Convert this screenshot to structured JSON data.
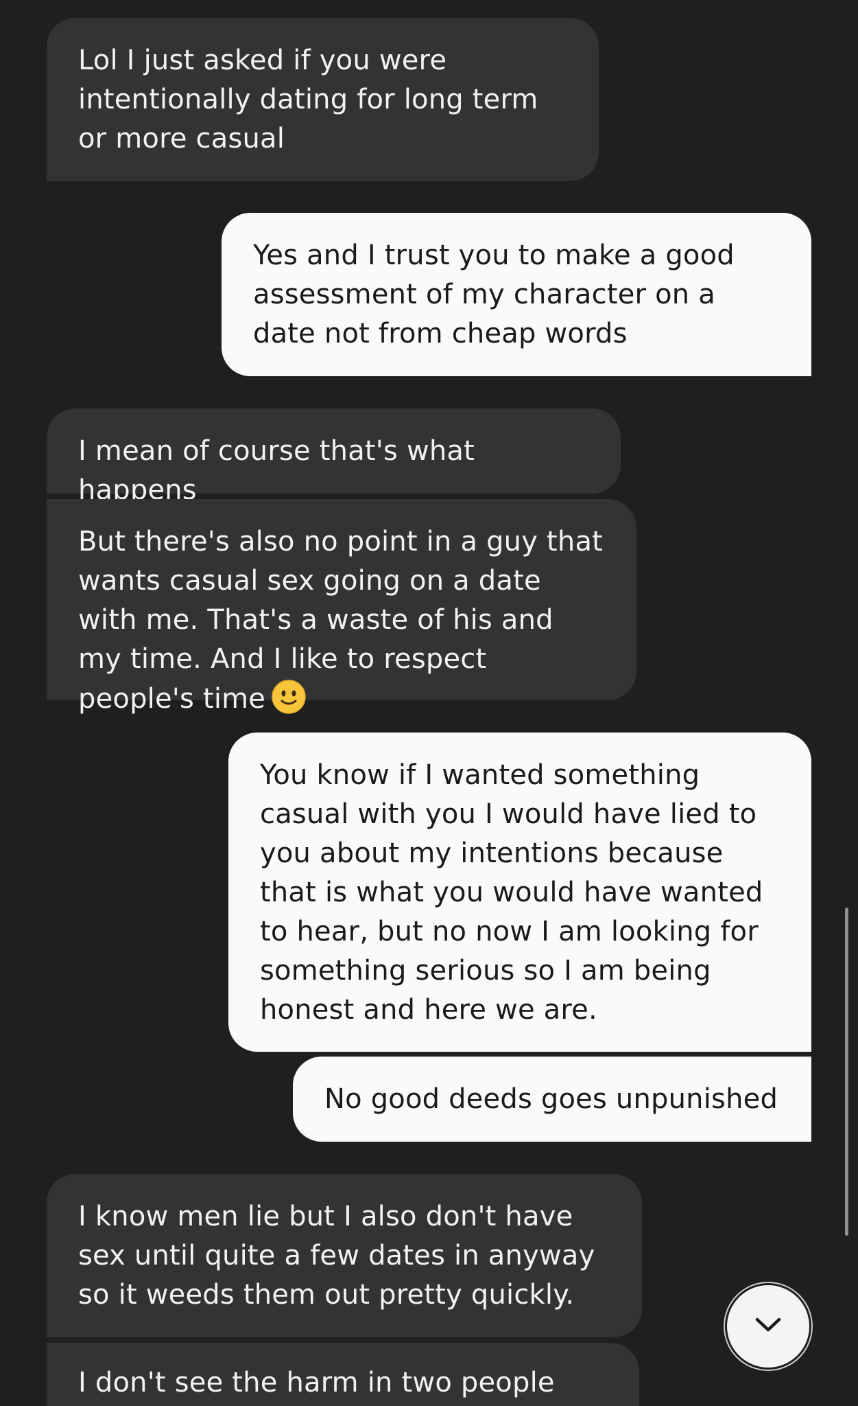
{
  "messages": [
    {
      "sender": "them",
      "text": "Lol I just asked if you were intentionally dating for long term or more casual"
    },
    {
      "sender": "me",
      "text": "Yes and I trust you to make a good assessment of my character on a date not from cheap words"
    },
    {
      "sender": "them",
      "text": "I mean of course that's what happens"
    },
    {
      "sender": "them",
      "text": "But there's also no point in a guy that wants casual sex going on a date with me. That's a waste of his and my time. And I like to respect people's time",
      "emoji": "slightly-smiling-face"
    },
    {
      "sender": "me",
      "text": "You know if I wanted something casual with you I would have lied to you about my intentions because that is what you would have wanted to hear, but no now I am looking for something serious so I am being honest and here we are."
    },
    {
      "sender": "me",
      "text": "No good deeds goes unpunished"
    },
    {
      "sender": "them",
      "text": "I know men lie but I also don't have sex until quite a few dates in anyway so it weeds them out pretty quickly."
    },
    {
      "sender": "them",
      "text": "I don't see the harm in two people"
    }
  ],
  "colors": {
    "background": "#1f1f1f",
    "incoming_bubble": "#333333",
    "outgoing_bubble": "#fafafa"
  },
  "scroll_button": {
    "icon": "chevron-down-icon"
  }
}
